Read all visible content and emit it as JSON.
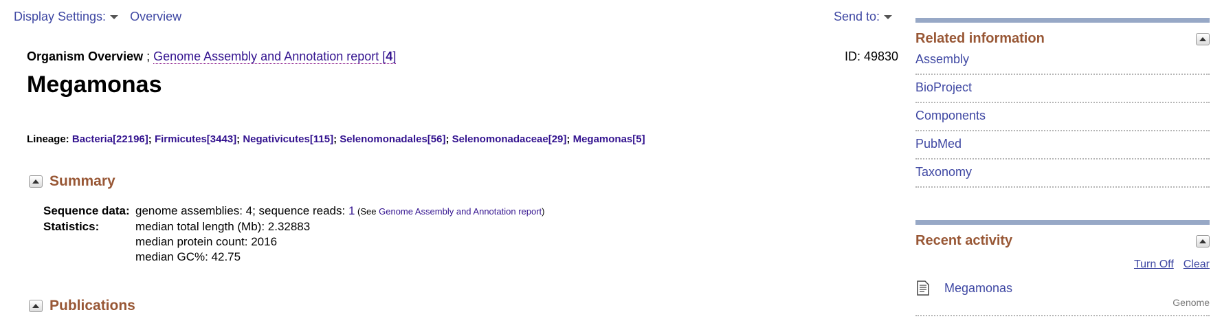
{
  "topbar": {
    "display_settings": "Display Settings:",
    "overview": "Overview",
    "send_to": "Send to:"
  },
  "header": {
    "organism_overview": "Organism Overview",
    "sep": " ; ",
    "report_link": "Genome Assembly and Annotation report [",
    "report_count": "4",
    "report_close": "]",
    "id_label": "ID: 49830",
    "title": "Megamonas"
  },
  "lineage": {
    "label": "Lineage:",
    "items": [
      {
        "name": "Bacteria",
        "count": "[22196]"
      },
      {
        "name": "Firmicutes",
        "count": "[3443]"
      },
      {
        "name": "Negativicutes",
        "count": "[115]"
      },
      {
        "name": "Selenomonadales",
        "count": "[56]"
      },
      {
        "name": "Selenomonadaceae",
        "count": "[29]"
      },
      {
        "name": "Megamonas",
        "count": "[5]"
      }
    ]
  },
  "summary": {
    "heading": "Summary",
    "seq_label": "Sequence data:",
    "seq_text": "genome assemblies: 4; sequence reads: ",
    "seq_reads_link": "1",
    "see_open": " (See ",
    "see_link": "Genome Assembly and Annotation report",
    "see_close": ")",
    "stats_label": "Statistics:",
    "stats": [
      "median total length (Mb): 2.32883",
      "median protein count: 2016",
      "median GC%: 42.75"
    ]
  },
  "publications": {
    "heading": "Publications"
  },
  "related": {
    "heading": "Related information",
    "links": [
      "Assembly",
      "BioProject",
      "Components",
      "PubMed",
      "Taxonomy"
    ]
  },
  "recent": {
    "heading": "Recent activity",
    "turn_off": "Turn Off",
    "clear": "Clear",
    "item_title": "Megamonas",
    "item_type": "Genome",
    "item_icon": "document-icon"
  }
}
